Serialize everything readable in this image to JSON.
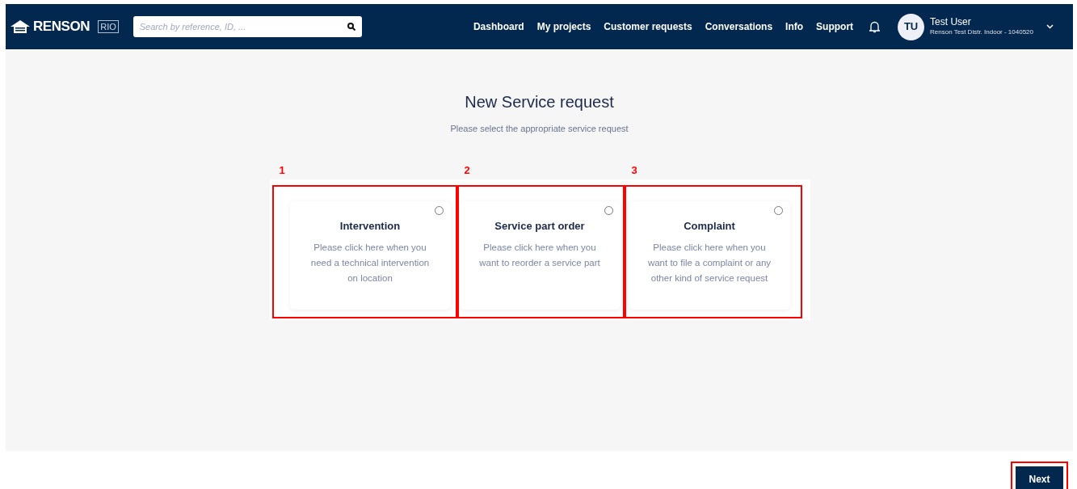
{
  "header": {
    "logo_text": "RENSON",
    "logo_badge": "RIO",
    "search": {
      "placeholder": "Search by reference, ID, ..."
    },
    "nav": [
      {
        "label": "Dashboard"
      },
      {
        "label": "My projects"
      },
      {
        "label": "Customer requests"
      },
      {
        "label": "Conversations"
      },
      {
        "label": "Info"
      },
      {
        "label": "Support"
      }
    ],
    "user": {
      "initials": "TU",
      "name": "Test User",
      "account": "Renson Test Distr. Indoor - 1040520"
    }
  },
  "title": "New Service request",
  "subtitle": "Please select the appropriate service request",
  "options": [
    {
      "marker": "1",
      "title": "Intervention",
      "description": "Please click here when you need a technical intervention on location",
      "selected": false
    },
    {
      "marker": "2",
      "title": "Service part order",
      "description": "Please click here when you want to reorder a service part",
      "selected": false
    },
    {
      "marker": "3",
      "title": "Complaint",
      "description": "Please click here when you want to file a complaint or any other kind of service request",
      "selected": false
    }
  ],
  "next_button": "Next"
}
